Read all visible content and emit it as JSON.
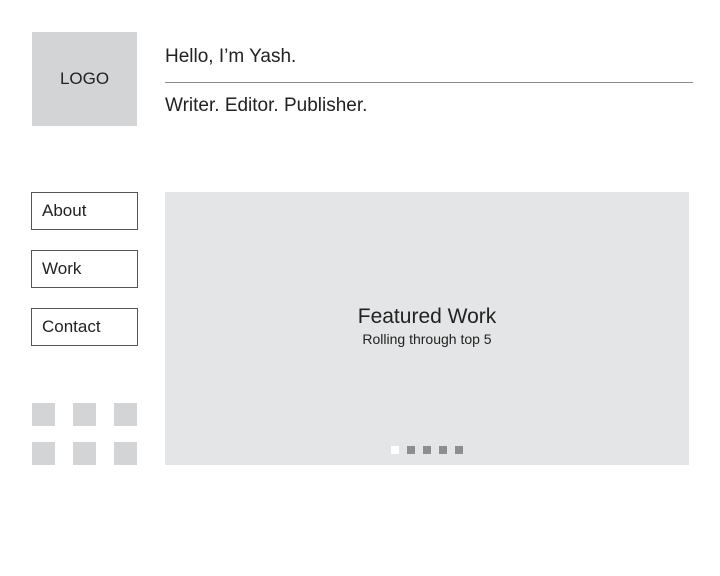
{
  "header": {
    "logo_text": "LOGO",
    "greeting": "Hello, I’m Yash.",
    "tagline": "Writer. Editor. Publisher."
  },
  "nav": {
    "items": [
      {
        "label": "About"
      },
      {
        "label": "Work"
      },
      {
        "label": "Contact"
      }
    ]
  },
  "social": {
    "icons": [
      "social-icon",
      "social-icon",
      "social-icon",
      "social-icon",
      "social-icon",
      "social-icon"
    ]
  },
  "hero": {
    "title": "Featured Work",
    "subtitle": "Rolling through top 5",
    "slide_count": 5,
    "active_slide": 1
  },
  "colors": {
    "placeholder": "#d3d4d5",
    "hero_bg": "#e4e5e6",
    "dot_inactive": "#8e8e8e",
    "dot_active": "#ffffff",
    "divider": "#8a8a8a"
  }
}
